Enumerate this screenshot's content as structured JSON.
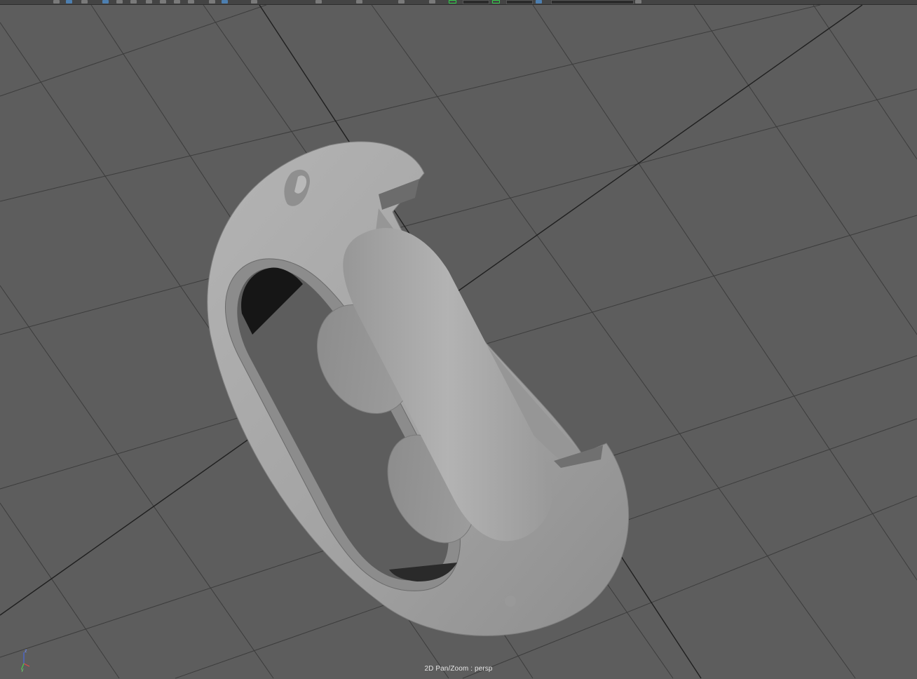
{
  "viewport": {
    "hud_label": "2D Pan/Zoom : persp",
    "background_color": "#5d5d5d",
    "grid_color": "#3a3a3a",
    "axis_line_color": "#1e1e1e",
    "model_color": "#a9a9a9"
  },
  "axis_gizmo": {
    "x_label": "x",
    "y_label": "y",
    "z_label": "z",
    "x_color": "#e04a4a",
    "y_color": "#4ad04a",
    "z_color": "#4a6ae0"
  },
  "toolbar": {
    "icons": [
      "select-icon",
      "lasso-icon",
      "paint-icon",
      "move-icon",
      "rotate-icon",
      "scale-icon",
      "snap-grid-icon",
      "snap-curve-icon",
      "snap-point-icon",
      "history-icon",
      "render-icon",
      "ipr-icon",
      "settings-icon"
    ]
  }
}
